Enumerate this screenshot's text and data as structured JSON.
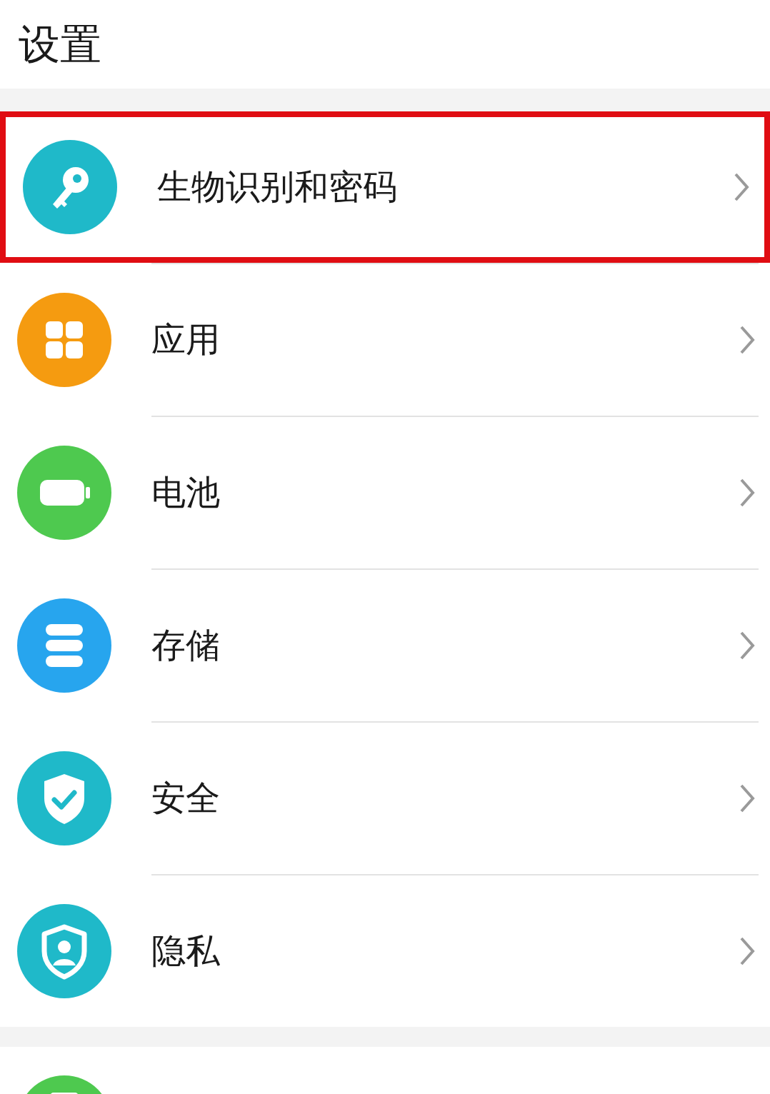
{
  "title": "设置",
  "groups": [
    {
      "items": [
        {
          "label": "生物识别和密码",
          "kind": "key",
          "color": "#1fb9c9",
          "highlighted": true
        },
        {
          "label": "应用",
          "kind": "apps",
          "color": "#f59b10",
          "highlighted": false
        },
        {
          "label": "电池",
          "kind": "battery",
          "color": "#4ec94f",
          "highlighted": false
        },
        {
          "label": "存储",
          "kind": "storage",
          "color": "#27a5ee",
          "highlighted": false
        },
        {
          "label": "安全",
          "kind": "security",
          "color": "#1fb9c9",
          "highlighted": false
        },
        {
          "label": "隐私",
          "kind": "privacy",
          "color": "#1fb9c9",
          "highlighted": false
        }
      ]
    },
    {
      "items": [
        {
          "kind": "partial",
          "color": "#4ec94f",
          "highlighted": false
        }
      ]
    }
  ]
}
